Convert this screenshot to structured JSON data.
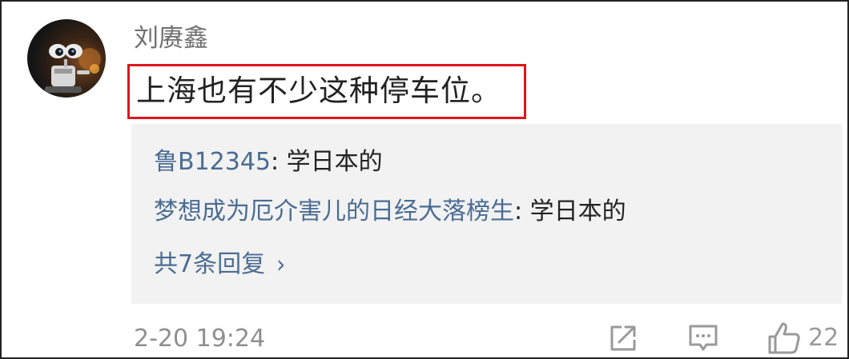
{
  "comment": {
    "username": "刘赓鑫",
    "text": "上海也有不少这种停车位。",
    "timestamp": "2-20 19:24",
    "like_count": "22",
    "highlight_color": "#e0161c"
  },
  "replies": [
    {
      "author": "鲁B12345",
      "separator": ": ",
      "text": "学日本的"
    },
    {
      "author": "梦想成为厄介害儿的日经大落榜生",
      "separator": ": ",
      "text": "学日本的"
    }
  ],
  "more_replies": {
    "label": "共7条回复",
    "icon": "chevron-right-icon"
  },
  "actions": {
    "share_icon": "share-icon",
    "reply_icon": "comment-icon",
    "like_icon": "thumbs-up-icon"
  },
  "colors": {
    "link": "#4a6c93",
    "text": "#222222",
    "muted": "#8f8f8f",
    "panel": "#f2f2f2"
  }
}
